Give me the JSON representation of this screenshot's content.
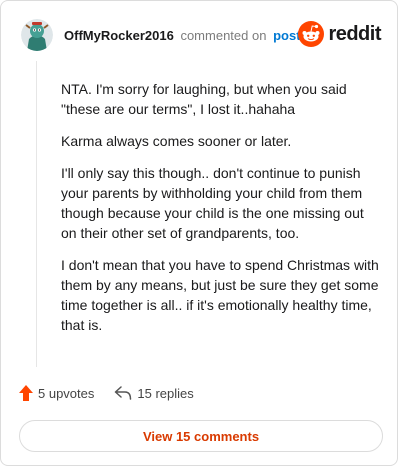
{
  "header": {
    "username": "OffMyRocker2016",
    "action_text": "commented on",
    "post_link": "post"
  },
  "brand": {
    "wordmark": "reddit",
    "icon": "reddit-logo-icon",
    "color": "#ff4500"
  },
  "comment": {
    "paragraphs": [
      "NTA. I'm sorry for laughing, but when you said \"these are our terms\", I lost it..hahaha",
      "Karma always comes sooner or later.",
      "I'll only say this though.. don't continue to punish your parents by withholding your child from them though because your child is the one missing out on their other set of grandparents, too.",
      "I don't mean that you have to spend Christmas with them by any means, but just be sure they get some time together is all.. if it's emotionally healthy time, that is."
    ]
  },
  "actions": {
    "upvotes": "5 upvotes",
    "replies": "15 replies",
    "upvote_icon": "upvote-arrow-icon",
    "reply_icon": "reply-arrow-icon",
    "upvote_color": "#ff4500"
  },
  "footer": {
    "view_comments": "View 15 comments",
    "accent": "#d93a00"
  }
}
